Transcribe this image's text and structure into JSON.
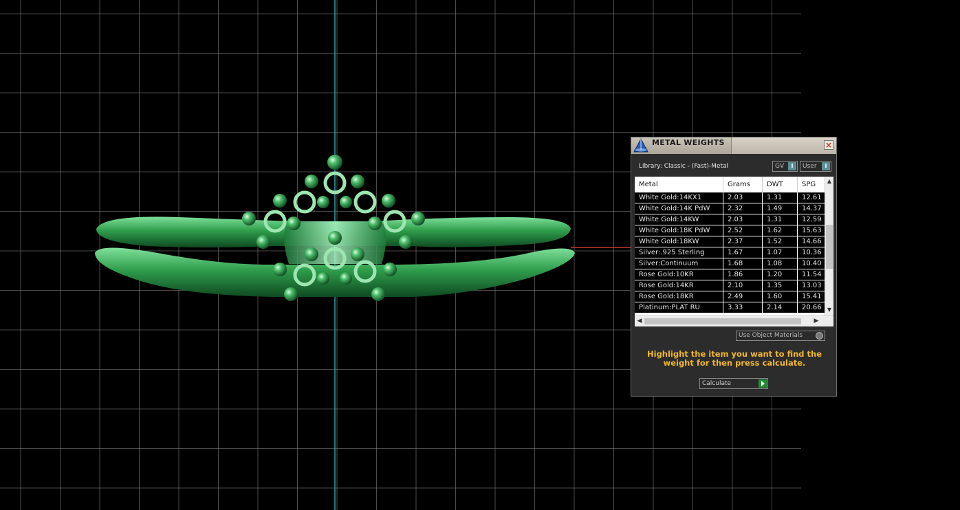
{
  "viewport": {
    "background_color": "#000000",
    "grid_color": "#8a8a8a",
    "vertical_axis_color": "#2aa6b0",
    "horizontal_axis_color": "#c0392b",
    "model_color": "#3fae5a"
  },
  "panel": {
    "title": "METAL WEIGHTS",
    "close_icon": "close-icon",
    "library_label": "Library: Classic - (Fast)-Metal",
    "combo_gv": "GV",
    "combo_user": "User",
    "table": {
      "headers": [
        "Metal",
        "Grams",
        "DWT",
        "SPG"
      ],
      "rows": [
        [
          "White Gold:14KX1",
          "2.03",
          "1.31",
          "12.61"
        ],
        [
          "White Gold:14K PdW",
          "2.32",
          "1.49",
          "14.37"
        ],
        [
          "White Gold:14KW",
          "2.03",
          "1.31",
          "12.59"
        ],
        [
          "White Gold:18K PdW",
          "2.52",
          "1.62",
          "15.63"
        ],
        [
          "White Gold:18KW",
          "2.37",
          "1.52",
          "14.66"
        ],
        [
          "Silver:.925 Sterling",
          "1.67",
          "1.07",
          "10.36"
        ],
        [
          "Silver:Continuum",
          "1.68",
          "1.08",
          "10.40"
        ],
        [
          "Rose Gold:10KR",
          "1.86",
          "1.20",
          "11.54"
        ],
        [
          "Rose Gold:14KR",
          "2.10",
          "1.35",
          "13.03"
        ],
        [
          "Rose Gold:18KR",
          "2.49",
          "1.60",
          "15.41"
        ],
        [
          "Platinum:PLAT RU",
          "3.33",
          "2.14",
          "20.66"
        ]
      ]
    },
    "use_object_materials": "Use Object Materials",
    "hint": "Highlight the item you want to find the weight for then press calculate.",
    "calculate_label": "Calculate",
    "accent_color": "#f2b72a"
  }
}
